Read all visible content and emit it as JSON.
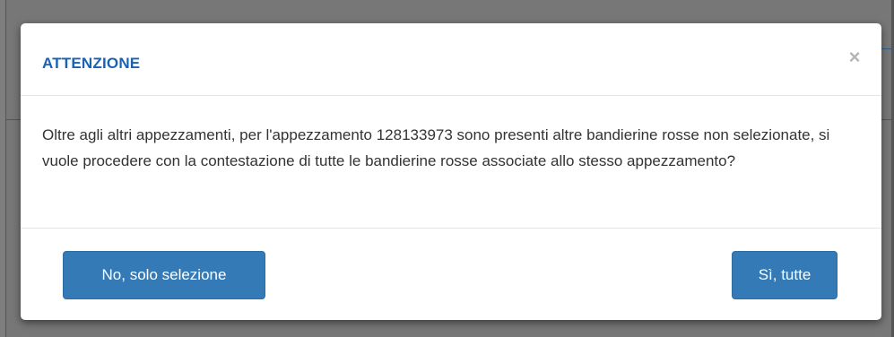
{
  "dialog": {
    "title": "ATTENZIONE",
    "close_label": "×",
    "message": "Oltre agli altri appezzamenti, per l'appezzamento 128133973 sono presenti altre bandierine rosse non selezionate, si vuole procedere con la contestazione di tutte le bandierine rosse associate allo stesso appezzamento?",
    "buttons": {
      "no_label": "No, solo selezione",
      "yes_label": "Sì, tutte"
    }
  },
  "colors": {
    "title": "#1a62b4",
    "button_bg": "#337ab7",
    "backdrop": "#777777",
    "text": "#333333"
  },
  "icons": {
    "close": "close-icon"
  }
}
